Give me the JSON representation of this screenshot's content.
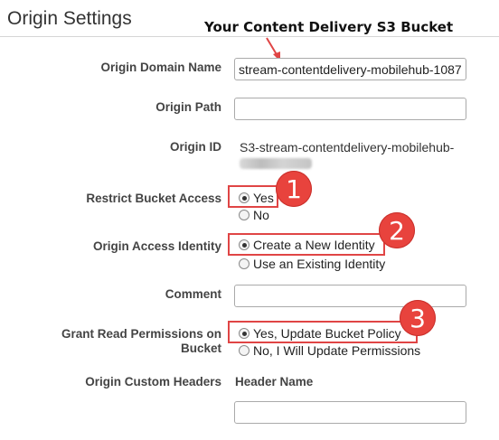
{
  "section": {
    "title": "Origin Settings"
  },
  "annotation": {
    "callout": "Your Content Delivery S3 Bucket",
    "markers": [
      "1",
      "2",
      "3"
    ],
    "highlight_color": "#e04545",
    "badge_color": "#e8433d"
  },
  "fields": {
    "origin_domain_name": {
      "label": "Origin Domain Name",
      "value": "stream-contentdelivery-mobilehub-1087"
    },
    "origin_path": {
      "label": "Origin Path",
      "value": ""
    },
    "origin_id": {
      "label": "Origin ID",
      "value": "S3-stream-contentdelivery-mobilehub-"
    },
    "restrict_bucket_access": {
      "label": "Restrict Bucket Access",
      "options": [
        {
          "label": "Yes",
          "selected": true
        },
        {
          "label": "No",
          "selected": false
        }
      ]
    },
    "origin_access_identity": {
      "label": "Origin Access Identity",
      "options": [
        {
          "label": "Create a New Identity",
          "selected": true
        },
        {
          "label": "Use an Existing Identity",
          "selected": false
        }
      ]
    },
    "comment": {
      "label": "Comment",
      "value": ""
    },
    "grant_read_permissions": {
      "label_line1": "Grant Read Permissions on",
      "label_line2": "Bucket",
      "options": [
        {
          "label": "Yes, Update Bucket Policy",
          "selected": true
        },
        {
          "label": "No, I Will Update Permissions",
          "selected": false
        }
      ]
    },
    "origin_custom_headers": {
      "label": "Origin Custom Headers",
      "column_header": "Header Name",
      "value": ""
    }
  }
}
